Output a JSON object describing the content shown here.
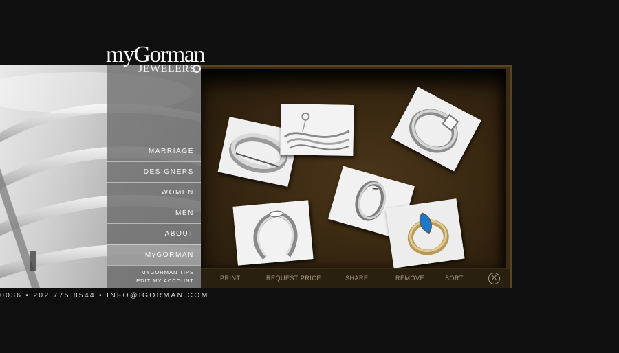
{
  "brand": {
    "logo_main": "myGorman",
    "logo_sub": "JEWELERS"
  },
  "nav": {
    "items": [
      {
        "label": "MARRIAGE"
      },
      {
        "label": "DESIGNERS"
      },
      {
        "label": "WOMEN"
      },
      {
        "label": "MEN"
      },
      {
        "label": "ABOUT"
      },
      {
        "label": "MyGORMAN",
        "active": true
      }
    ],
    "tips_label": "MYGORMAN TIPS",
    "account_label": "EDIT MY ACCOUNT"
  },
  "toolbar": {
    "print": "PRINT",
    "request_price": "REQUEST PRICE",
    "share": "SHARE",
    "remove": "REMOVE",
    "sort": "SORT",
    "close_icon": "close-circle-icon"
  },
  "showcase": {
    "photos": [
      {
        "subject": "two-tone band with diamond"
      },
      {
        "subject": "wave-design pendant and rings"
      },
      {
        "subject": "princess-cut solitaire twist ring"
      },
      {
        "subject": "narrow platinum band"
      },
      {
        "subject": "marquise diamond ring"
      },
      {
        "subject": "blue marquise stone gold ring"
      }
    ]
  },
  "contact": {
    "line": "0036 • 202.775.8544 • INFO@IGORMAN.COM"
  },
  "colors": {
    "background": "#0f0f0f",
    "nav_panel": "#737373",
    "tray": "#3a2912",
    "frame": "#5a4320",
    "toolbar_text": "#a89a84"
  }
}
